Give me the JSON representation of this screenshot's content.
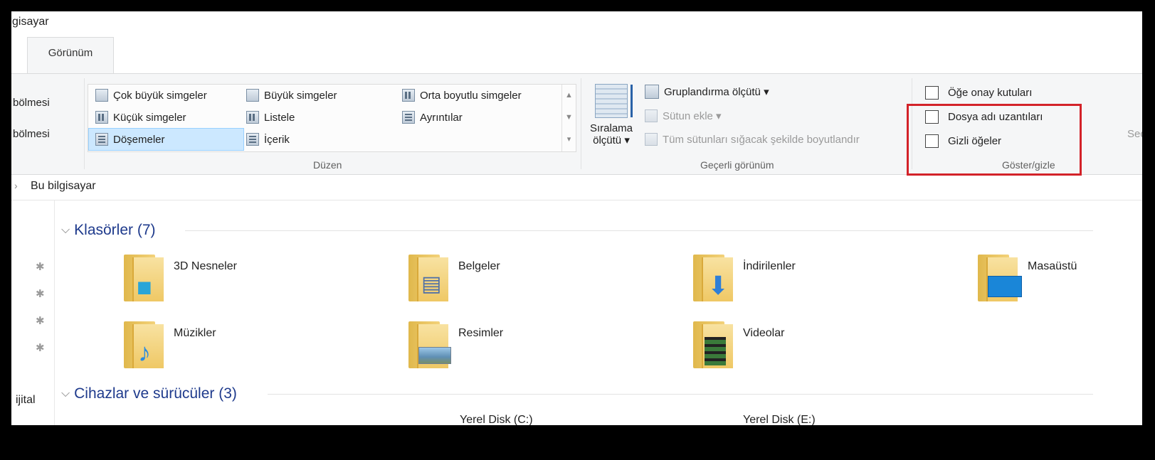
{
  "window": {
    "title": "gisayar"
  },
  "tabs": [
    {
      "label": "Görünüm"
    }
  ],
  "ribbon": {
    "panes": {
      "pane1_label": "bölmesi",
      "pane2_label": "bölmesi"
    },
    "layout": {
      "items": [
        {
          "label": "Çok büyük simgeler"
        },
        {
          "label": "Büyük simgeler"
        },
        {
          "label": "Orta boyutlu simgeler"
        },
        {
          "label": "Küçük simgeler"
        },
        {
          "label": "Listele"
        },
        {
          "label": "Ayrıntılar"
        },
        {
          "label": "Döşemeler",
          "selected": true
        },
        {
          "label": "İçerik"
        }
      ],
      "group_label": "Düzen"
    },
    "current_view": {
      "sort_label_line1": "Sıralama",
      "sort_label_line2": "ölçütü ▾",
      "group_by": "Gruplandırma ölçütü ▾",
      "add_column": "Sütun ekle ▾",
      "fit_columns": "Tüm sütunları sığacak şekilde boyutlandır",
      "group_label": "Geçerli görünüm"
    },
    "show_hide": {
      "item_checkboxes": "Öğe onay kutuları",
      "file_name_extensions": "Dosya adı uzantıları",
      "hidden_items": "Gizli öğeler",
      "group_label": "Göster/gizle",
      "checked": {
        "item_checkboxes": false,
        "file_name_extensions": false,
        "hidden_items": false
      },
      "highlight_color": "#d32229"
    },
    "next_group_partial": "Seç"
  },
  "address": {
    "breadcrumb": "Bu bilgisayar"
  },
  "nav": {
    "partial_item": "ijital"
  },
  "sections": {
    "folders": {
      "title": "Klasörler (7)",
      "items": [
        {
          "name": "3D Nesneler",
          "icon": "3d-objects-folder-icon"
        },
        {
          "name": "Belgeler",
          "icon": "documents-folder-icon"
        },
        {
          "name": "İndirilenler",
          "icon": "downloads-folder-icon"
        },
        {
          "name": "Masaüstü",
          "icon": "desktop-folder-icon"
        },
        {
          "name": "Müzikler",
          "icon": "music-folder-icon"
        },
        {
          "name": "Resimler",
          "icon": "pictures-folder-icon"
        },
        {
          "name": "Videolar",
          "icon": "videos-folder-icon"
        }
      ]
    },
    "drives": {
      "title": "Cihazlar ve sürücüler (3)",
      "items": [
        {
          "name": "Yerel Disk (C:)"
        },
        {
          "name": "Yerel Disk (E:)"
        }
      ]
    }
  },
  "colors": {
    "accent": "#1e3a8c",
    "selection": "#cce8ff",
    "ribbon_bg": "#f5f6f7"
  }
}
